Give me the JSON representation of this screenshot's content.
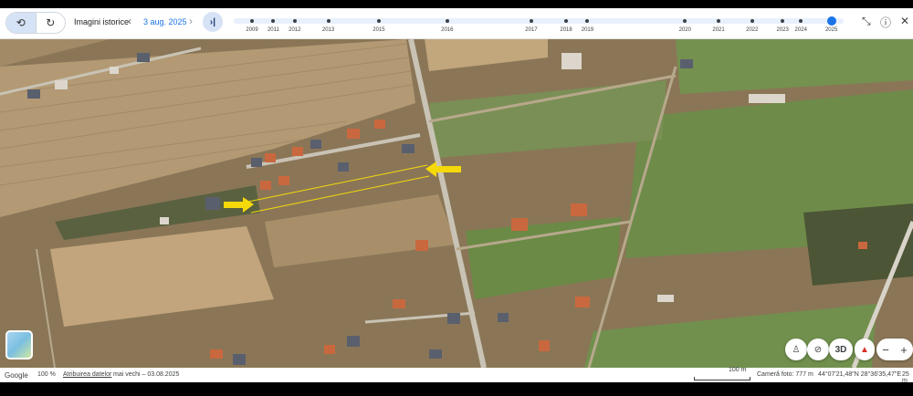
{
  "toolbar": {
    "history_title": "Imagini istorice",
    "current_date": "3 aug. 2025",
    "prev_icon": "chevron-left-icon",
    "next_icon": "chevron-right-icon",
    "last_icon": "skip-to-end-icon",
    "buttons": [
      "history-icon",
      "rotate-icon"
    ]
  },
  "timeline": {
    "years": [
      {
        "label": "2009",
        "pos": 0.03
      },
      {
        "label": "2011",
        "pos": 0.065
      },
      {
        "label": "2012",
        "pos": 0.1
      },
      {
        "label": "2013",
        "pos": 0.155
      },
      {
        "label": "2015",
        "pos": 0.238
      },
      {
        "label": "2016",
        "pos": 0.35
      },
      {
        "label": "2017",
        "pos": 0.488
      },
      {
        "label": "2018",
        "pos": 0.545
      },
      {
        "label": "2019",
        "pos": 0.58
      },
      {
        "label": "2020",
        "pos": 0.74
      },
      {
        "label": "2021",
        "pos": 0.795
      },
      {
        "label": "2022",
        "pos": 0.85
      },
      {
        "label": "2023",
        "pos": 0.9
      },
      {
        "label": "2024",
        "pos": 0.93
      },
      {
        "label": "2025",
        "pos": 0.98
      }
    ],
    "current_year": "2025"
  },
  "top_right": {
    "collapse_icon": "collapse-icon",
    "help_icon": "help-icon",
    "close_icon": "close-icon"
  },
  "map_controls": {
    "person": "pegman-icon",
    "no_tilt": "tilt-off-icon",
    "view_3d": "3D",
    "compass": "compass-icon",
    "zoom_out": "−",
    "zoom_in": "+"
  },
  "footer": {
    "google": "Google",
    "zoom": "100 %",
    "attribution": "Atribuirea datelor",
    "older": "mai vechi – 03.08.2025",
    "scale": "100 m",
    "camera": "Cameră foto: 777 m",
    "coords": "44°07'21,48\"N 28°36'35,47\"E",
    "alt": "25 m"
  },
  "colors": {
    "accent": "#1a73e8",
    "field_light": "#b9a27f",
    "field_green": "#6f8a4a",
    "arrow": "#f5d90a"
  }
}
